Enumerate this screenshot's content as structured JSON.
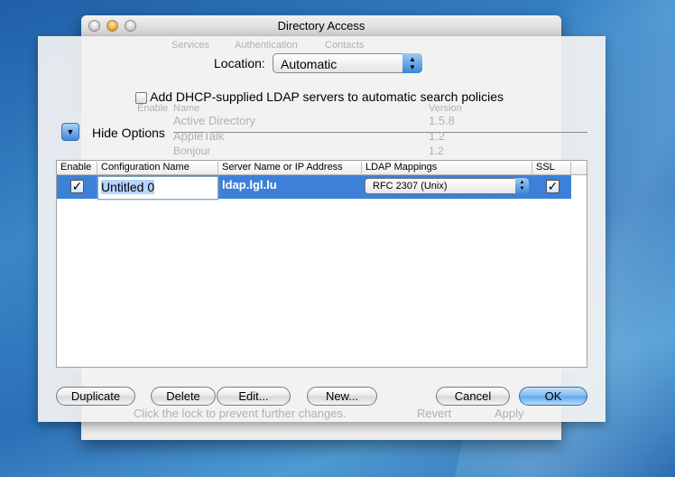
{
  "window": {
    "title": "Directory Access"
  },
  "background_window": {
    "tabs": [
      "Services",
      "Authentication",
      "Contacts"
    ],
    "columns": [
      "Enable",
      "Name",
      "Version"
    ],
    "rows": [
      {
        "name": "Active Directory",
        "version": "1.5.8"
      },
      {
        "name": "AppleTalk",
        "version": "1.2"
      },
      {
        "name": "Bonjour",
        "version": "1.2"
      }
    ],
    "lock_text": "Click the lock to prevent further changes.",
    "revert": "Revert",
    "apply": "Apply"
  },
  "sheet": {
    "location_label": "Location:",
    "location_value": "Automatic",
    "dhcp_label": "Add DHCP-supplied LDAP servers to automatic search policies",
    "dhcp_checked": false,
    "hide_options": "Hide Options",
    "table": {
      "columns": [
        "Enable",
        "Configuration Name",
        "Server Name or IP Address",
        "LDAP Mappings",
        "SSL"
      ],
      "rows": [
        {
          "enable": true,
          "name": "Untitled 0",
          "server": "ldap.lgl.lu",
          "mapping": "RFC 2307 (Unix)",
          "ssl": true,
          "selected": true
        }
      ]
    },
    "buttons": {
      "duplicate": "Duplicate",
      "delete": "Delete",
      "edit": "Edit...",
      "new": "New...",
      "cancel": "Cancel",
      "ok": "OK"
    }
  },
  "colors": {
    "selection": "#3d80d8",
    "accent": "#5ea6ea"
  }
}
